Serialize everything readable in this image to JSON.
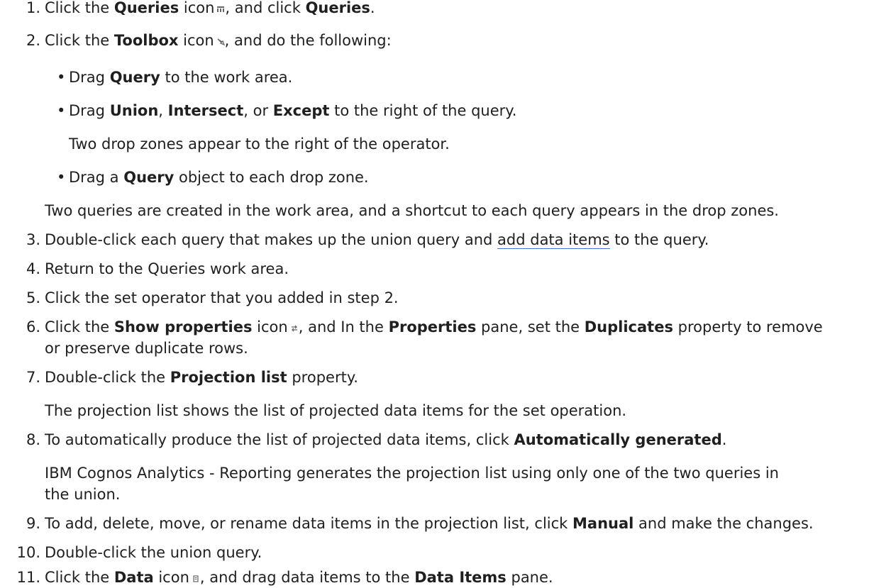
{
  "steps": {
    "s1": {
      "num": "1.",
      "a": "Click the ",
      "b1": "Queries",
      "c": " icon",
      "d": ", and click ",
      "b2": "Queries",
      "e": "."
    },
    "s2": {
      "num": "2.",
      "a": "Click the ",
      "b1": "Toolbox",
      "c": " icon",
      "d": ", and do the following:"
    },
    "s2_bullets": {
      "i1": {
        "a": "Drag ",
        "b1": "Query",
        "c": " to the work area."
      },
      "i2": {
        "a": "Drag ",
        "b1": "Union",
        "c": ", ",
        "b2": "Intersect",
        "d": ", or ",
        "b3": "Except",
        "e": " to the right of the query."
      },
      "i2_note": "Two drop zones appear to the right of the operator.",
      "i3": {
        "a": "Drag a ",
        "b1": "Query",
        "c": " object to each drop zone."
      }
    },
    "s2_result": "Two queries are created in the work area, and a shortcut to each query appears in the drop zones.",
    "s3": {
      "num": "3.",
      "a": "Double-click each query that makes up the union query and ",
      "link": "add data items",
      "b": " to the query."
    },
    "s4": {
      "num": "4.",
      "a": "Return to the Queries work area."
    },
    "s5": {
      "num": "5.",
      "a": "Click the set operator that you added in step 2."
    },
    "s6": {
      "num": "6.",
      "a": "Click the ",
      "b1": "Show properties",
      "c": " icon",
      "d": ", and In the ",
      "b2": "Properties",
      "e": " pane, set the ",
      "b3": "Duplicates",
      "f": " property to remove",
      "g": "or preserve duplicate rows."
    },
    "s7": {
      "num": "7.",
      "a": "Double-click the ",
      "b1": "Projection list",
      "c": " property."
    },
    "s7_result": "The projection list shows the list of projected data items for the set operation.",
    "s8": {
      "num": "8.",
      "a": "To automatically produce the list of projected data items, click ",
      "b1": "Automatically generated",
      "c": "."
    },
    "s8_result1": "IBM Cognos Analytics - Reporting generates the projection list using only one of the two queries in",
    "s8_result2": "the union.",
    "s9": {
      "num": "9.",
      "a": "To add, delete, move, or rename data items in the projection list, click ",
      "b1": "Manual",
      "c": " and make the changes."
    },
    "s10": {
      "num": "10.",
      "a": "Double-click the union query."
    },
    "s11": {
      "num": "11.",
      "a": "Click the ",
      "b1": "Data",
      "c": " icon",
      "d": ", and drag data items to the ",
      "b2": "Data Items",
      "e": " pane."
    }
  },
  "bullet_char": "•",
  "icons": {
    "queries": "queries-icon",
    "toolbox": "toolbox-icon",
    "show_properties": "show-properties-icon",
    "data": "data-icon"
  },
  "colors": {
    "text": "#1f1f1f",
    "link_underline": "#4a6ee0",
    "icon": "#666666"
  }
}
